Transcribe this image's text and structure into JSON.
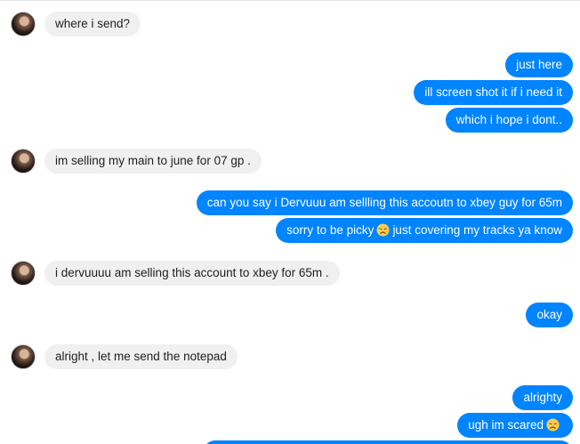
{
  "messages": [
    {
      "side": "in",
      "text": "where i send?"
    },
    {
      "side": "out",
      "text": "just here"
    },
    {
      "side": "out",
      "text": "ill screen shot it if i need it"
    },
    {
      "side": "out",
      "text": "which i hope i dont.."
    },
    {
      "side": "in",
      "text": "im selling my main to june for 07 gp ."
    },
    {
      "side": "out",
      "text": "can you say i Dervuuu am sellling this accoutn to xbey guy for 65m"
    },
    {
      "side": "out",
      "text_before": "sorry to be picky",
      "emoji": "disappointed-face",
      "text_after": "just covering my tracks ya know"
    },
    {
      "side": "in",
      "text": "i dervuuuu am selling this account to xbey for 65m ."
    },
    {
      "side": "out",
      "text": "okay"
    },
    {
      "side": "in",
      "text": "alright , let me send the notepad"
    },
    {
      "side": "out",
      "text": "alrighty"
    },
    {
      "side": "out",
      "text_before": "ugh im scared",
      "emoji": "disappointed-face",
      "text_after": ""
    }
  ],
  "colors": {
    "outgoing_bubble": "#0084ff",
    "incoming_bubble": "#f0f0f0",
    "emoji_face": "#ffcc4d"
  }
}
